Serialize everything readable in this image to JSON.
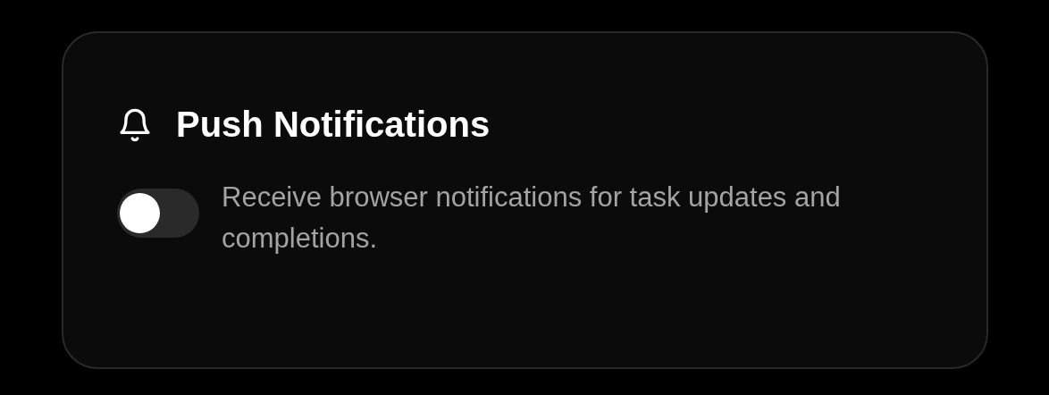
{
  "card": {
    "title": "Push Notifications",
    "toggle": {
      "on": false
    },
    "description": "Receive browser notifications for task updates and completions."
  }
}
